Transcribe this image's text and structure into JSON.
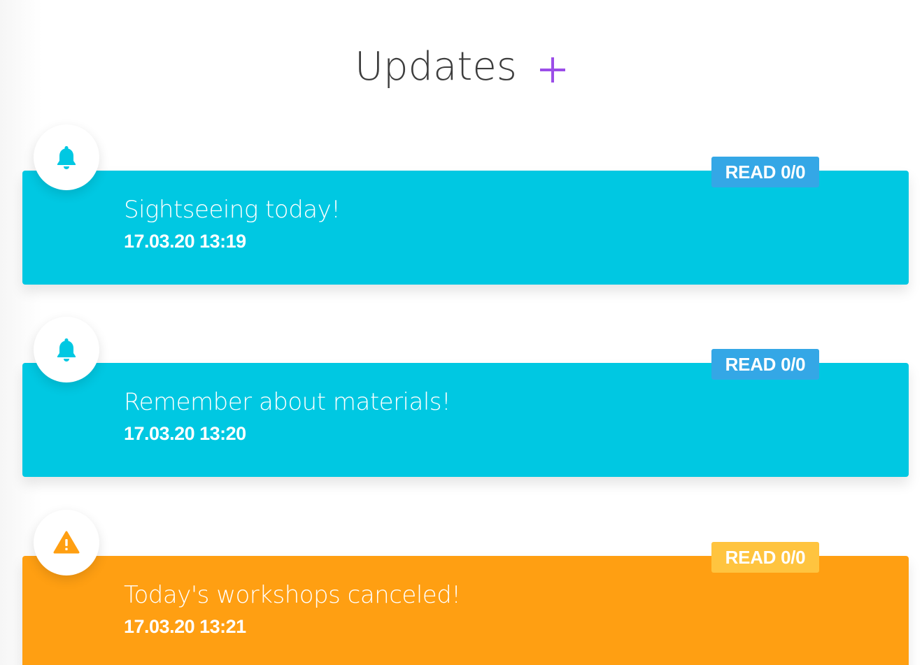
{
  "header": {
    "title": "Updates",
    "add_icon": "plus-icon",
    "accent_color": "#9b4de8"
  },
  "updates": [
    {
      "title": "Sightseeing today!",
      "time": "17.03.20 13:19",
      "read_badge": "READ 0/0",
      "icon": "bell-icon",
      "color": "#00c8e2"
    },
    {
      "title": "Remember about materials!",
      "time": "17.03.20 13:20",
      "read_badge": "READ 0/0",
      "icon": "bell-icon",
      "color": "#00c8e2"
    },
    {
      "title": "Today's workshops canceled!",
      "time": "17.03.20 13:21",
      "read_badge": "READ 0/0",
      "icon": "warning-icon",
      "color": "#ff9f12"
    }
  ]
}
